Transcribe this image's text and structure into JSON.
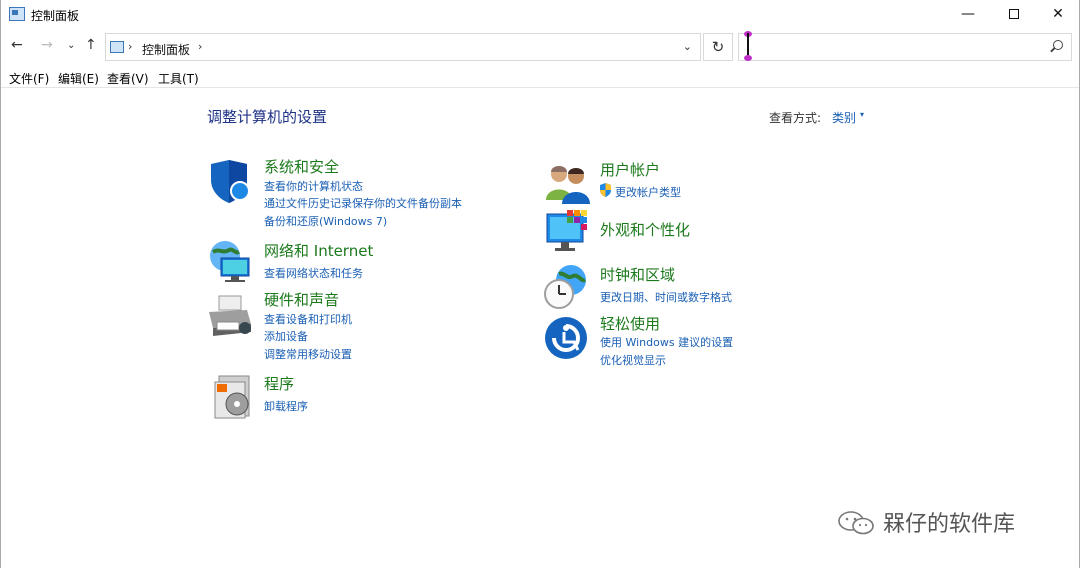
{
  "window": {
    "title": "控制面板",
    "minimize": "—",
    "close": "✕"
  },
  "nav": {
    "back": "←",
    "forward": "→",
    "recent": "⌄",
    "up": "↑",
    "breadcrumb": "控制面板",
    "sep": "›",
    "dropdown": "⌄",
    "refresh": "↻",
    "search_value": ""
  },
  "menu": [
    "文件(F)",
    "编辑(E)",
    "查看(V)",
    "工具(T)"
  ],
  "content": {
    "heading": "调整计算机的设置",
    "viewby_label": "查看方式:",
    "viewby_value": "类别",
    "viewby_caret": "▾"
  },
  "categories_left": [
    {
      "title": "系统和安全",
      "icon": "shield-icon",
      "links": [
        "查看你的计算机状态",
        "通过文件历史记录保存你的文件备份副本",
        "备份和还原(Windows 7)"
      ]
    },
    {
      "title": "网络和 Internet",
      "icon": "network-icon",
      "links": [
        "查看网络状态和任务"
      ]
    },
    {
      "title": "硬件和声音",
      "icon": "printer-icon",
      "links": [
        "查看设备和打印机",
        "添加设备",
        "调整常用移动设置"
      ]
    },
    {
      "title": "程序",
      "icon": "programs-icon",
      "links": [
        "卸载程序"
      ]
    }
  ],
  "categories_right": [
    {
      "title": "用户帐户",
      "icon": "users-icon",
      "links": [
        "更改帐户类型"
      ]
    },
    {
      "title": "外观和个性化",
      "icon": "display-icon",
      "links": []
    },
    {
      "title": "时钟和区域",
      "icon": "clock-globe-icon",
      "links": [
        "更改日期、时间或数字格式"
      ]
    },
    {
      "title": "轻松使用",
      "icon": "accessibility-icon",
      "links": [
        "使用 Windows 建议的设置",
        "优化视觉显示"
      ]
    }
  ],
  "watermark": "槑仔的软件库",
  "colors": {
    "category_title": "#1c7a1c",
    "link": "#1a5fb4",
    "heading": "#1e3287"
  }
}
